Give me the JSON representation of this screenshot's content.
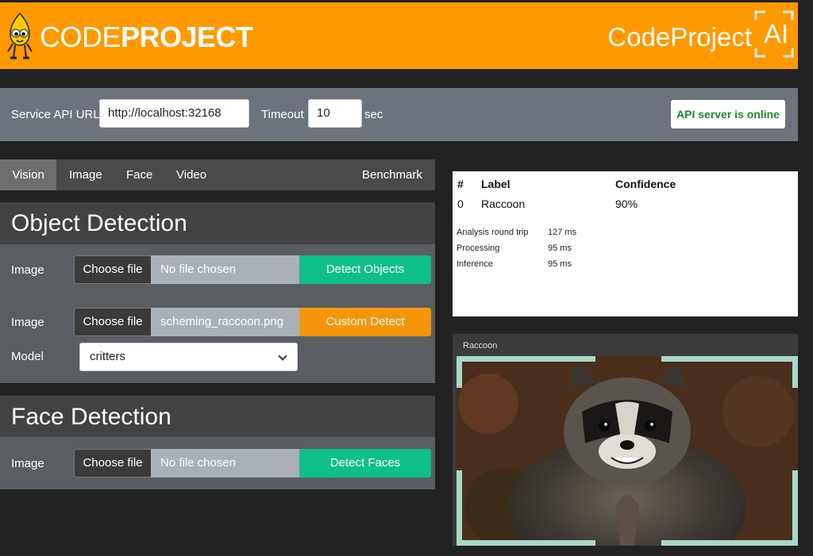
{
  "header": {
    "logo_light": "CODE",
    "logo_bold": "PROJECT",
    "brand_right": "CodeProject",
    "brand_ai": "AI",
    "brand_color": "#ff9900"
  },
  "api": {
    "url_label": "Service API URL",
    "url_value": "http://localhost:32168",
    "timeout_label": "Timeout",
    "timeout_value": "10",
    "timeout_unit": "sec",
    "status": "API server is online"
  },
  "tabs": [
    {
      "label": "Vision",
      "active": true
    },
    {
      "label": "Image",
      "active": false
    },
    {
      "label": "Face",
      "active": false
    },
    {
      "label": "Video",
      "active": false
    },
    {
      "label": "Benchmark",
      "active": false
    }
  ],
  "object_detection": {
    "title": "Object Detection",
    "row1": {
      "label": "Image",
      "choose": "Choose file",
      "file": "No file chosen",
      "button": "Detect Objects"
    },
    "row2": {
      "label": "Image",
      "choose": "Choose file",
      "file": "scheming_raccoon.png",
      "button": "Custom Detect"
    },
    "model": {
      "label": "Model",
      "value": "critters"
    }
  },
  "face_detection": {
    "title": "Face Detection",
    "row": {
      "label": "Image",
      "choose": "Choose file",
      "file": "No file chosen",
      "button": "Detect Faces"
    }
  },
  "results": {
    "headers": [
      "#",
      "Label",
      "Confidence"
    ],
    "rows": [
      {
        "index": "0",
        "label": "Raccoon",
        "confidence": "90%"
      }
    ],
    "stats": [
      {
        "name": "Analysis round trip",
        "value": "127 ms"
      },
      {
        "name": "Processing",
        "value": "95 ms"
      },
      {
        "name": "Inference",
        "value": "95 ms"
      }
    ]
  },
  "image_preview": {
    "caption": "Raccoon"
  },
  "colors": {
    "green": "#0fbf8a",
    "orange": "#f5960a",
    "online_text": "#1a8a2a",
    "bbox": "#a8d8c8"
  }
}
